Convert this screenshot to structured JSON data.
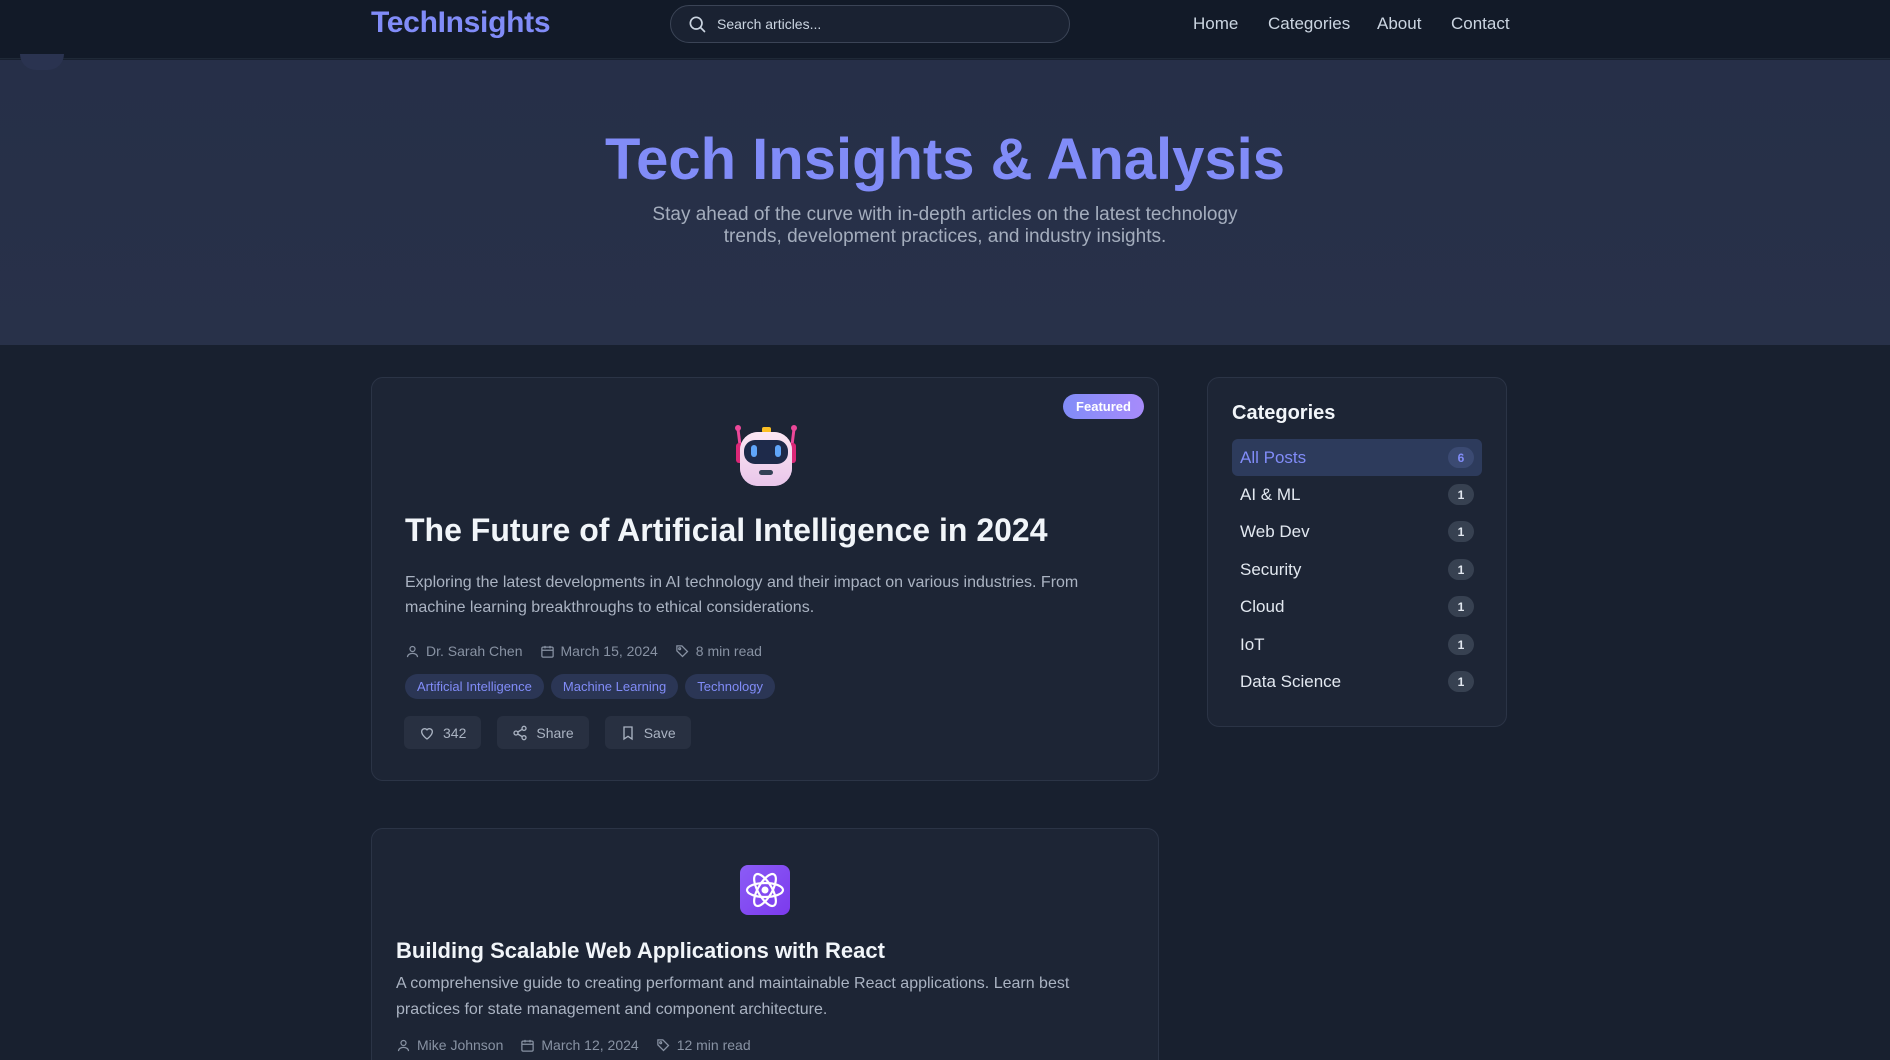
{
  "header": {
    "logo": "TechInsights",
    "search_placeholder": "Search articles...",
    "nav": [
      "Home",
      "Categories",
      "About",
      "Contact"
    ]
  },
  "hero": {
    "title": "Tech Insights & Analysis",
    "subtitle": "Stay ahead of the curve with in-depth articles on the latest technology trends, development practices, and industry insights."
  },
  "posts": [
    {
      "badge": "Featured",
      "icon": "robot-icon",
      "title": "The Future of Artificial Intelligence in 2024",
      "excerpt": "Exploring the latest developments in AI technology and their impact on various industries. From machine learning breakthroughs to ethical considerations.",
      "author": "Dr. Sarah Chen",
      "date": "March 15, 2024",
      "read_time": "8 min read",
      "tags": [
        "Artificial Intelligence",
        "Machine Learning",
        "Technology"
      ],
      "likes": "342",
      "share_label": "Share",
      "save_label": "Save"
    },
    {
      "icon": "atom-icon",
      "title": "Building Scalable Web Applications with React",
      "excerpt": "A comprehensive guide to creating performant and maintainable React applications. Learn best practices for state management and component architecture.",
      "author": "Mike Johnson",
      "date": "March 12, 2024",
      "read_time": "12 min read"
    }
  ],
  "sidebar": {
    "title": "Categories",
    "items": [
      {
        "label": "All Posts",
        "count": "6",
        "active": true
      },
      {
        "label": "AI & ML",
        "count": "1"
      },
      {
        "label": "Web Dev",
        "count": "1"
      },
      {
        "label": "Security",
        "count": "1"
      },
      {
        "label": "Cloud",
        "count": "1"
      },
      {
        "label": "IoT",
        "count": "1"
      },
      {
        "label": "Data Science",
        "count": "1"
      }
    ]
  },
  "colors": {
    "accent": "#818cf8",
    "background": "#18202f",
    "card": "#1d2535"
  }
}
